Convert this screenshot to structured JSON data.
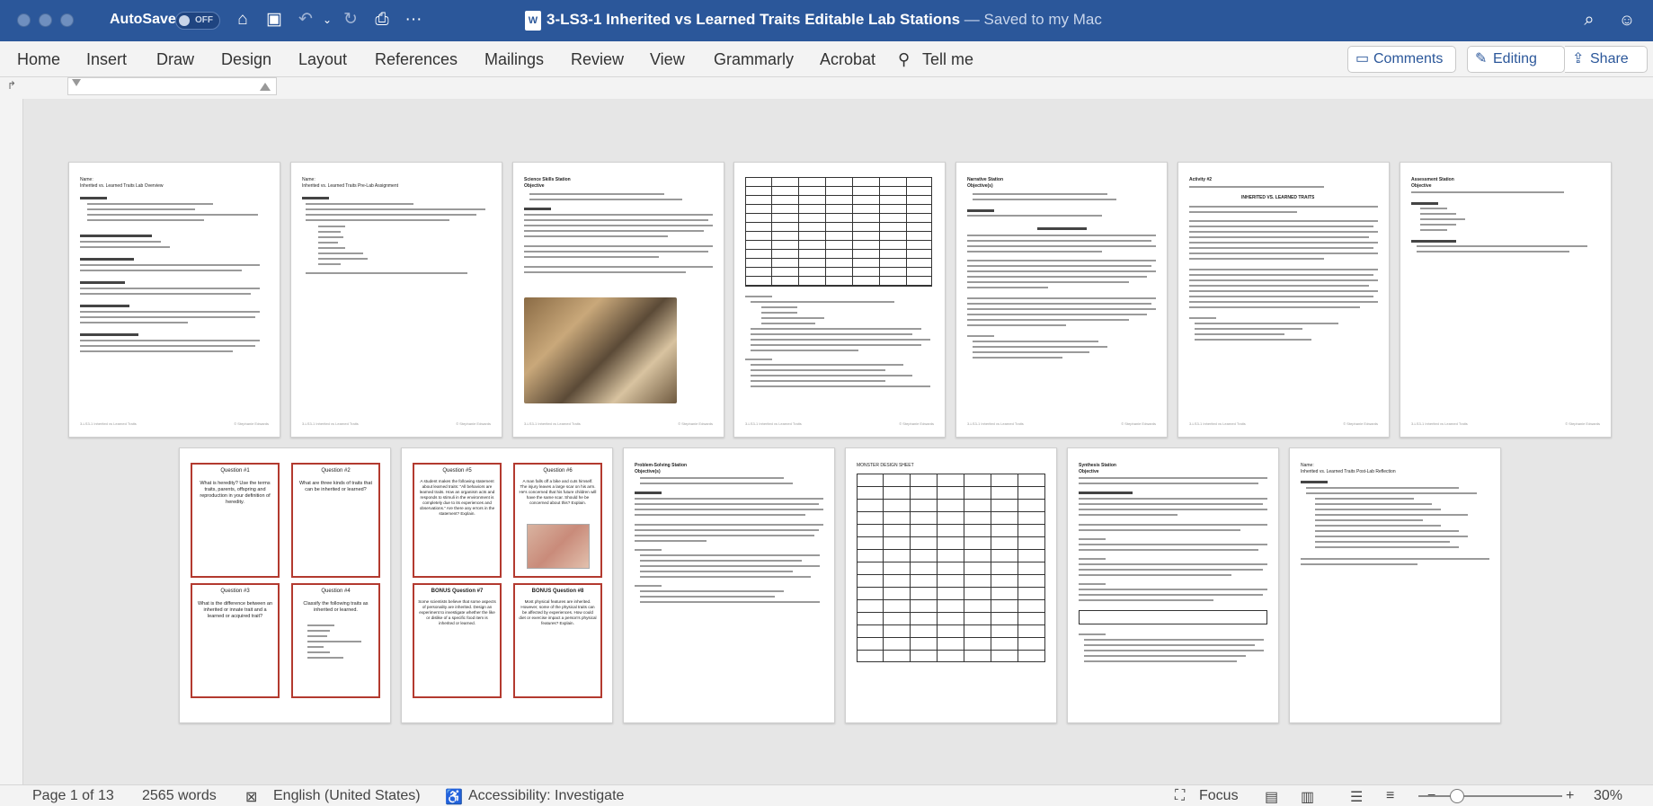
{
  "window": {
    "autosave_label": "AutoSave",
    "autosave_state": "OFF",
    "title": "3-LS3-1 Inherited vs Learned Traits Editable Lab Stations",
    "saved_status": "— Saved to my Mac",
    "doc_icon": "W"
  },
  "toolbar_icons": [
    "home-icon",
    "save-icon",
    "undo-icon",
    "undo-dropdown-icon",
    "redo-icon",
    "print-icon",
    "more-icon"
  ],
  "ribbon": {
    "tabs": [
      "Home",
      "Insert",
      "Draw",
      "Design",
      "Layout",
      "References",
      "Mailings",
      "Review",
      "View",
      "Grammarly",
      "Acrobat"
    ],
    "tell_me": "Tell me",
    "comments": "Comments",
    "editing": "Editing",
    "share": "Share"
  },
  "pages_row1": [
    {
      "heading": "Name:",
      "subtitle": "Inherited vs. Learned Traits Lab Overview",
      "footer_left": "3-LS3-1 Inherited vs Learned Traits",
      "footer_right": "© Stephanie Edwards"
    },
    {
      "heading": "Name:",
      "subtitle": "Inherited vs. Learned Traits Pre-Lab Assignment",
      "footer_left": "3-LS3-1 Inherited vs Learned Traits",
      "footer_right": "© Stephanie Edwards"
    },
    {
      "heading": "Science Skills Station",
      "subtitle": "Objective",
      "footer_left": "3-LS3-1 Inherited vs Learned Traits",
      "footer_right": "© Stephanie Edwards"
    },
    {
      "heading": "",
      "subtitle": "",
      "footer_left": "3-LS3-1 Inherited vs Learned Traits",
      "footer_right": "© Stephanie Edwards"
    },
    {
      "heading": "Narrative Station",
      "subtitle": "Objective(s)",
      "footer_left": "3-LS3-1 Inherited vs Learned Traits",
      "footer_right": "© Stephanie Edwards"
    },
    {
      "heading": "Activity #2",
      "subtitle": "INHERITED VS. LEARNED TRAITS",
      "footer_left": "3-LS3-1 Inherited vs Learned Traits",
      "footer_right": "© Stephanie Edwards"
    },
    {
      "heading": "Assessment Station",
      "subtitle": "Objective",
      "footer_left": "3-LS3-1 Inherited vs Learned Traits",
      "footer_right": "© Stephanie Edwards"
    }
  ],
  "cards_page1": [
    {
      "title": "Question #1",
      "text": "What is heredity? Use the terms traits, parents, offspring and reproduction in your definition of heredity."
    },
    {
      "title": "Question #2",
      "text": "What are three kinds of traits that can be inherited or learned?"
    },
    {
      "title": "Question #3",
      "text": "What is the difference between an inherited or innate trait and a learned or acquired trait?"
    },
    {
      "title": "Question #4",
      "text": "Classify the following traits as inherited or learned."
    }
  ],
  "cards_page2": [
    {
      "title": "Question #5",
      "text": "A student makes the following statement about learned traits: \"All behaviors are learned traits. How an organism acts and responds to stimuli in the environment is completely due to its experiences and observations.\" Are there any errors in the statement? Explain."
    },
    {
      "title": "Question #6",
      "text": "A man falls off a bike and cuts himself. The injury leaves a large scar on his arm. He's concerned that his future children will have the same scar. Should he be concerned about this? Explain."
    },
    {
      "title": "BONUS Question #7",
      "text": "Some scientists believe that some aspects of personality are inherited. Design an experiment to investigate whether the like or dislike of a specific food item is inherited or learned."
    },
    {
      "title": "BONUS Question #8",
      "text": "Most physical features are inherited. However, some of the physical traits can be affected by experiences. How could diet or exercise impact a person's physical features? Explain."
    }
  ],
  "pages_row2": [
    {
      "heading": "Problem-Solving Station",
      "subtitle": "Objective(s)"
    },
    {
      "heading": "MONSTER DESIGN SHEET",
      "subtitle": ""
    },
    {
      "heading": "Synthesis Station",
      "subtitle": "Objective"
    },
    {
      "heading": "Name:",
      "subtitle": "Inherited vs. Learned Traits Post-Lab Reflection"
    }
  ],
  "status": {
    "page": "Page 1 of 13",
    "words": "2565 words",
    "language": "English (United States)",
    "accessibility": "Accessibility: Investigate",
    "focus": "Focus",
    "zoom": "30%"
  }
}
